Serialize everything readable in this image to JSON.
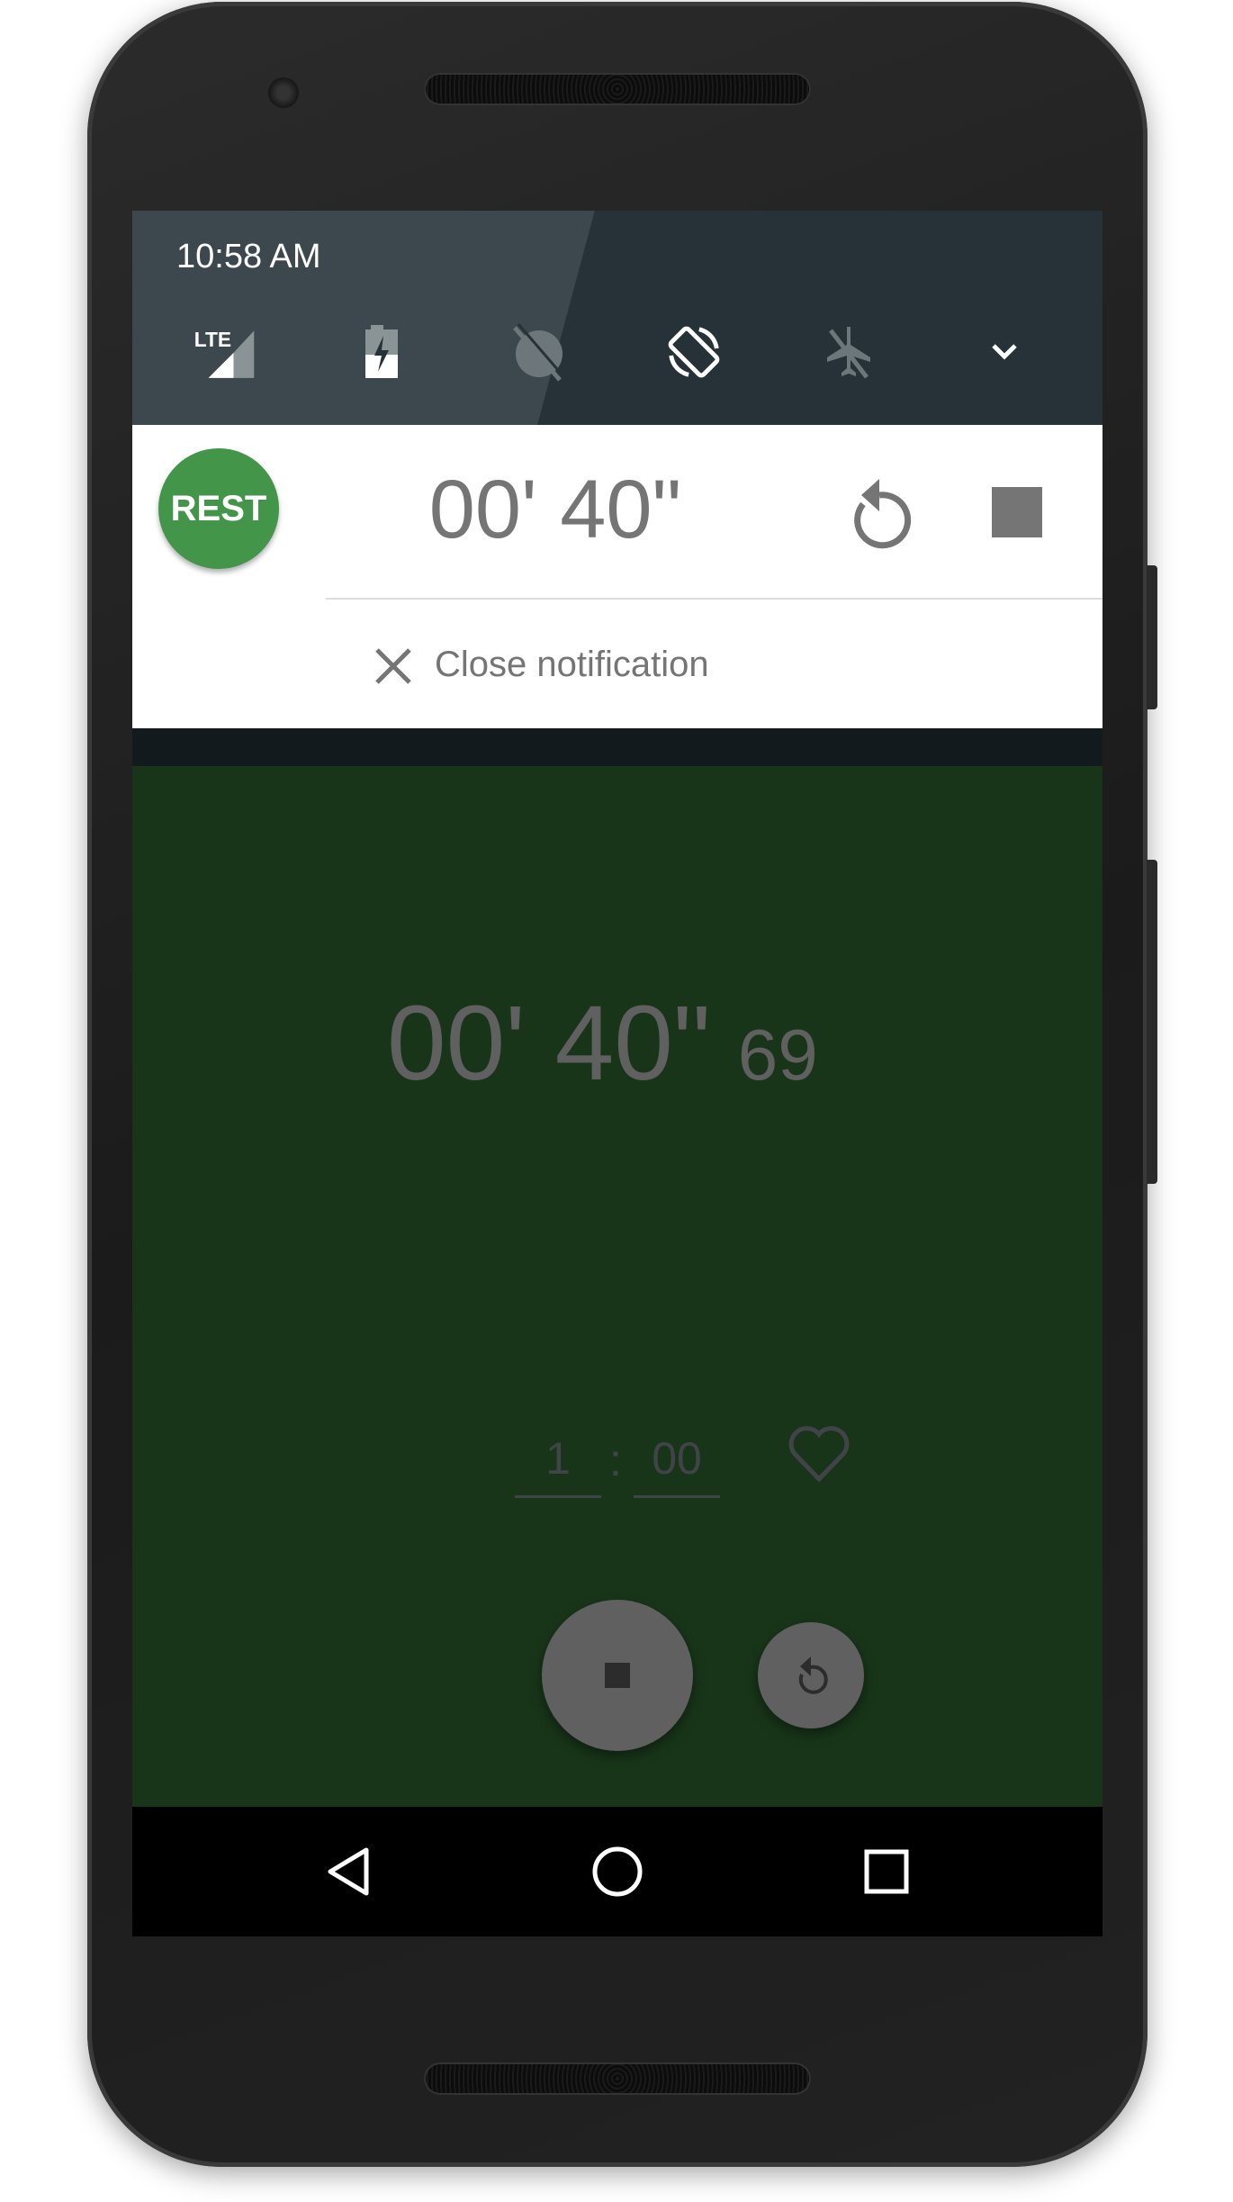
{
  "status_bar": {
    "time": "10:58 AM",
    "network": "LTE"
  },
  "quick_settings": {
    "icons": [
      "lte-signal-icon",
      "battery-charging-icon",
      "sync-off-icon",
      "auto-rotate-icon",
      "airplane-mode-icon",
      "expand-chevron-icon"
    ]
  },
  "notification": {
    "badge": "REST",
    "time": "00' 40\"",
    "close_label": "Close notification"
  },
  "app": {
    "timer_main": "00' 40\"",
    "timer_ms": "69",
    "minutes_value": "1",
    "separator": ":",
    "seconds_value": "00"
  },
  "colors": {
    "app_bg": "#183519",
    "badge": "#43954a",
    "fab": "#606060"
  }
}
